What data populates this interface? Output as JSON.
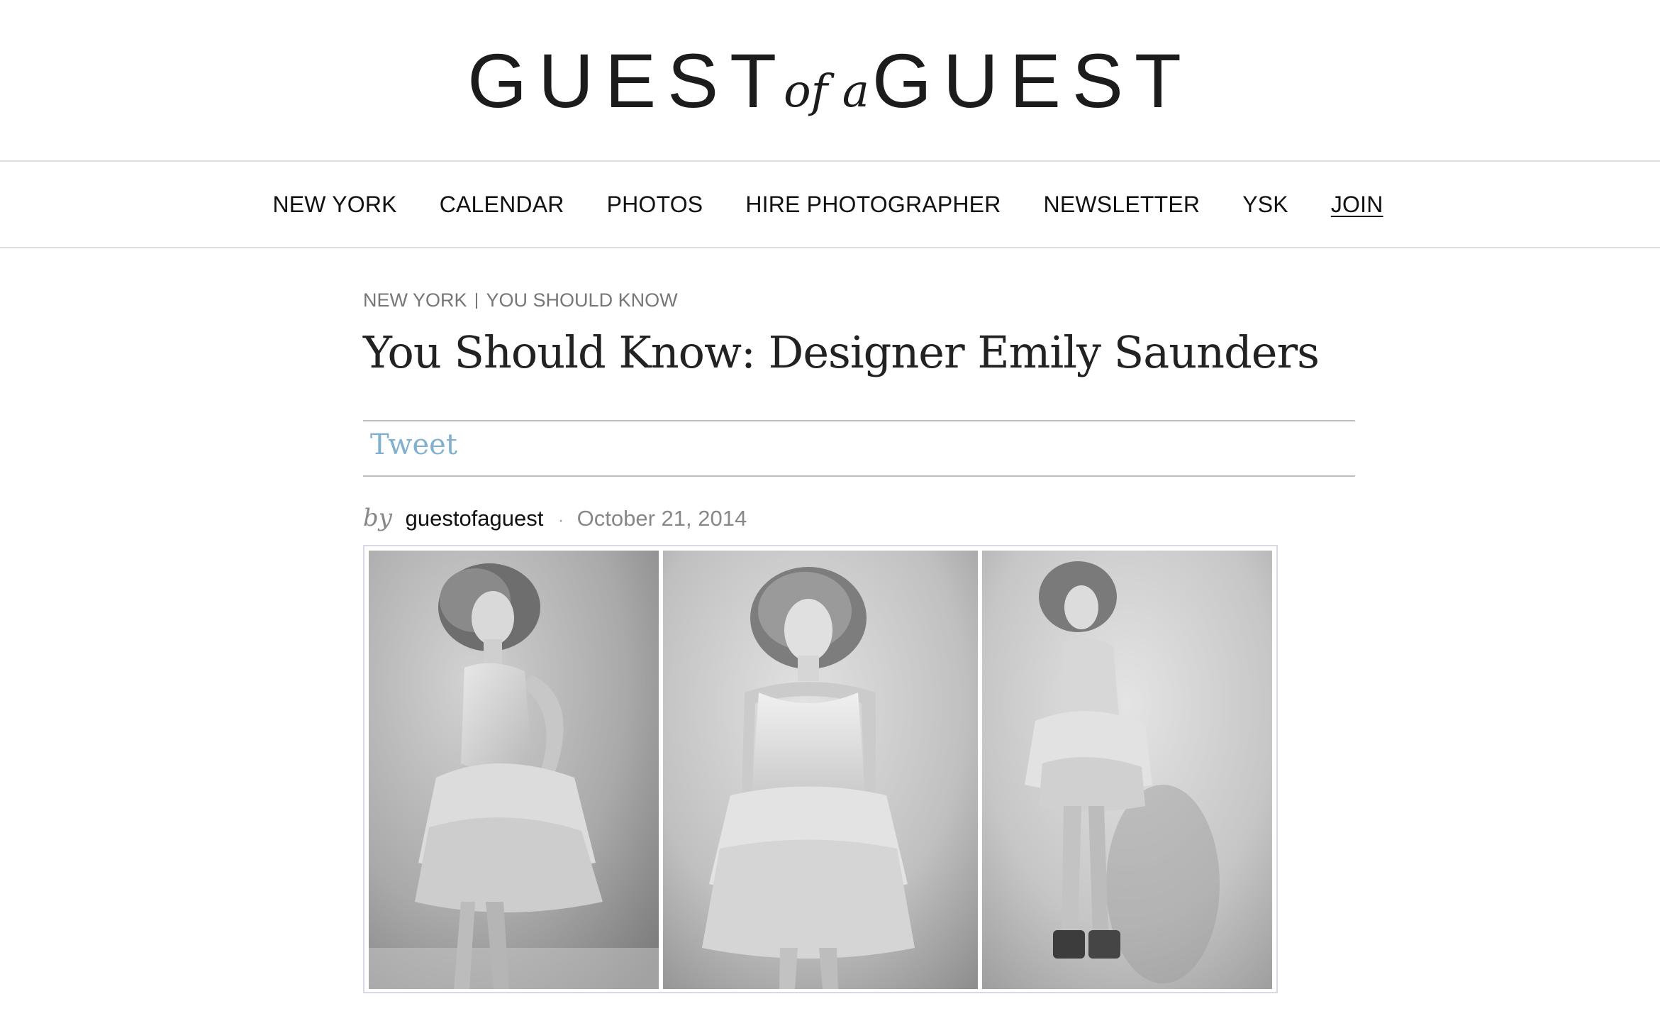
{
  "site": {
    "logo_left": "GUEST",
    "logo_middle": "of a",
    "logo_right": "GUEST"
  },
  "nav": {
    "items": [
      {
        "label": "NEW YORK"
      },
      {
        "label": "CALENDAR"
      },
      {
        "label": "PHOTOS"
      },
      {
        "label": "HIRE PHOTOGRAPHER"
      },
      {
        "label": "NEWSLETTER"
      },
      {
        "label": "YSK"
      },
      {
        "label": "JOIN"
      }
    ]
  },
  "article": {
    "breadcrumb": {
      "city": "NEW YORK",
      "section": "YOU SHOULD KNOW"
    },
    "title": "You Should Know: Designer Emily Saunders",
    "share": {
      "tweet_label": "Tweet",
      "tweet_color": "#7fb0d0"
    },
    "byline": {
      "by": "by",
      "author": "guestofaguest",
      "separator": "·",
      "date": "October 21, 2014"
    },
    "images": [
      {
        "description_icon": "photo-woman-profile",
        "tone": "black-and-white"
      },
      {
        "description_icon": "photo-woman-front",
        "tone": "black-and-white"
      },
      {
        "description_icon": "photo-woman-side",
        "tone": "black-and-white"
      }
    ]
  }
}
